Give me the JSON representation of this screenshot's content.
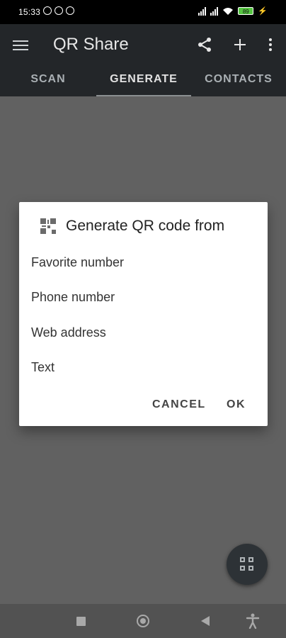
{
  "status_bar": {
    "time": "15:33",
    "battery": "89"
  },
  "app_bar": {
    "title": "QR Share"
  },
  "tabs": [
    {
      "label": "SCAN"
    },
    {
      "label": "GENERATE"
    },
    {
      "label": "CONTACTS"
    }
  ],
  "dialog": {
    "title": "Generate QR code from",
    "options": [
      {
        "label": "Favorite number"
      },
      {
        "label": "Phone number"
      },
      {
        "label": "Web address"
      },
      {
        "label": "Text"
      }
    ],
    "cancel_label": "CANCEL",
    "ok_label": "OK"
  },
  "icons": {
    "menu": "hamburger-icon",
    "share": "share-icon",
    "add": "plus-icon",
    "more": "more-vert-icon",
    "fab": "qr-code-icon",
    "nav_recent": "square-icon",
    "nav_home": "circle-icon",
    "nav_back": "triangle-left-icon",
    "accessibility": "accessibility-icon"
  }
}
